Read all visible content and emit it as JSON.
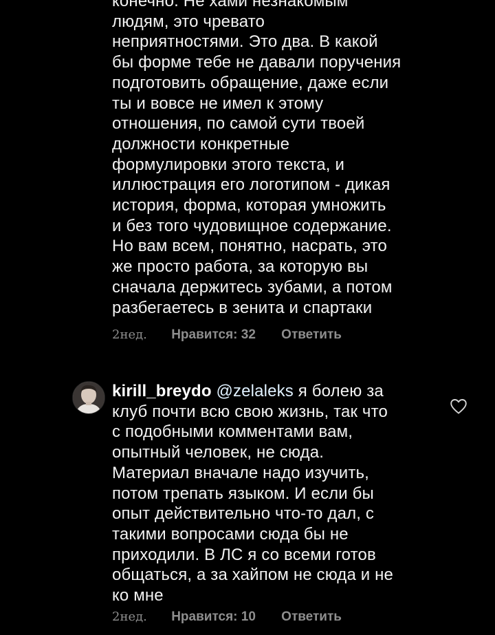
{
  "comment1": {
    "lines": [
      "конечно. Не хами незнакомым",
      "людям, это чревато",
      "неприятностями. Это два. В какой",
      "бы форме тебе не давали поручения",
      "подготовить обращение, даже если",
      "ты и вовсе не имел к этому",
      "отношения, по самой сути твоей",
      "должности конкретные",
      "формулировки этого текста, и",
      "иллюстрация его логотипом - дикая",
      "история, форма, которая умножить",
      "и без того чудовищное содержание.",
      "Но вам всем, понятно, насрать, это",
      "же просто работа, за которую вы",
      "сначала держитесь зубами, а потом",
      "разбегаетесь в зенита и спартаки"
    ],
    "time": "2нед.",
    "likes": "Нравится: 32",
    "reply": "Ответить"
  },
  "comment2": {
    "username": "kirill_breydo",
    "mention": "@zelaleks",
    "first_line_rest": " я болею за",
    "lines": [
      "клуб почти всю свою жизнь, так что",
      "с подобными комментами вам,",
      "опытный человек, не сюда.",
      "Материал вначале надо изучить,",
      "потом трепать языком. И если бы",
      "опыт действительно что-то дал, с",
      "такими вопросами сюда бы не",
      "приходили. В ЛС я со всеми готов",
      "общаться, а за хайпом не сюда и не",
      "ко мне"
    ],
    "time": "2нед.",
    "likes": "Нравится: 10",
    "reply": "Ответить",
    "like_icon": "heart-outline-icon"
  }
}
